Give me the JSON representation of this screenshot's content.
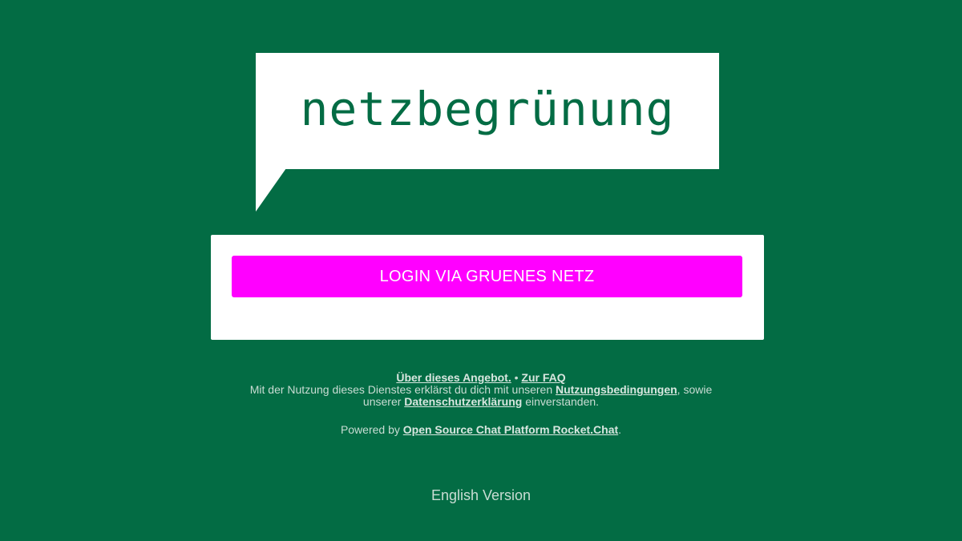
{
  "logo": {
    "text": "netzbegrünung"
  },
  "login": {
    "button_label": "LOGIN VIA GRUENES NETZ"
  },
  "footer": {
    "about_link": "Über dieses Angebot.",
    "separator": " • ",
    "faq_link": "Zur FAQ",
    "terms_prefix": "Mit der Nutzung dieses Dienstes erklärst du dich mit unseren ",
    "terms_link": "Nutzungsbedingungen",
    "terms_middle": ", sowie",
    "privacy_prefix": "unserer ",
    "privacy_link": "Datenschutzerklärung",
    "privacy_suffix": " einverstanden."
  },
  "powered": {
    "prefix": "Powered by ",
    "link": "Open Source Chat Platform Rocket.Chat",
    "suffix": "."
  },
  "language": {
    "label": "English Version"
  },
  "colors": {
    "background": "#036c44",
    "button": "#ff00ff",
    "card": "#ffffff"
  }
}
